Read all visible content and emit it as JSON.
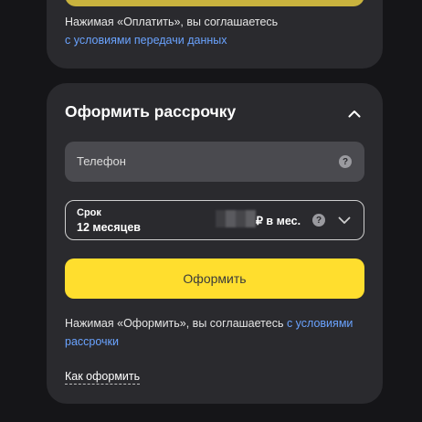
{
  "prev_card": {
    "terms_text": "Нажимая «Оплатить», вы соглашаетесь",
    "terms_link": "с условиями передачи данных"
  },
  "installment": {
    "title": "Оформить рассрочку",
    "phone_placeholder": "Телефон",
    "term_label": "Срок",
    "term_value": "12 месяцев",
    "monthly_suffix": "₽ в мес.",
    "submit_label": "Оформить",
    "terms_text": "Нажимая «Оформить», вы соглашаетесь ",
    "terms_link": "с условиями рассрочки",
    "how_link": "Как оформить",
    "help_glyph": "?"
  }
}
